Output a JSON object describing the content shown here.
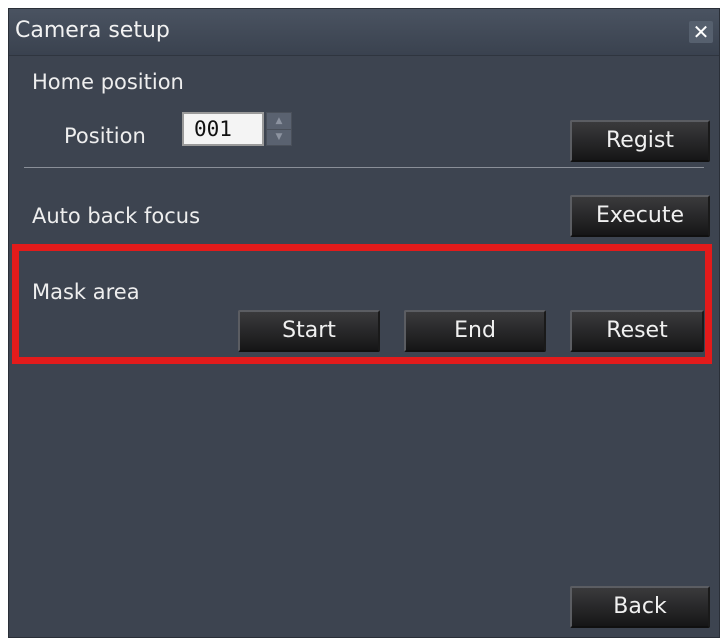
{
  "window": {
    "title": "Camera setup",
    "close_symbol": "✕"
  },
  "home_position": {
    "section_label": "Home position",
    "position_label": "Position",
    "position_value": "001",
    "regist_label": "Regist"
  },
  "auto_back_focus": {
    "label": "Auto back focus",
    "execute_label": "Execute"
  },
  "mask_area": {
    "label": "Mask area",
    "start_label": "Start",
    "end_label": "End",
    "reset_label": "Reset"
  },
  "footer": {
    "back_label": "Back"
  },
  "colors": {
    "panel_background": "#3d4450",
    "highlight": "#e31b1b",
    "button_background": "#1e1e20",
    "text": "#eeeeee"
  }
}
